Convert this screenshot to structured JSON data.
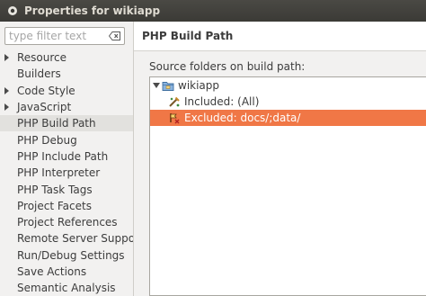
{
  "window": {
    "title": "Properties for wikiapp"
  },
  "sidebar": {
    "filter_placeholder": "type filter text",
    "items": [
      {
        "label": "Resource",
        "expandable": true
      },
      {
        "label": "Builders",
        "expandable": false
      },
      {
        "label": "Code Style",
        "expandable": true
      },
      {
        "label": "JavaScript",
        "expandable": true
      },
      {
        "label": "PHP Build Path",
        "expandable": false,
        "selected": true
      },
      {
        "label": "PHP Debug",
        "expandable": false
      },
      {
        "label": "PHP Include Path",
        "expandable": false
      },
      {
        "label": "PHP Interpreter",
        "expandable": false
      },
      {
        "label": "PHP Task Tags",
        "expandable": false
      },
      {
        "label": "Project Facets",
        "expandable": false
      },
      {
        "label": "Project References",
        "expandable": false
      },
      {
        "label": "Remote Server Suppor",
        "expandable": false
      },
      {
        "label": "Run/Debug Settings",
        "expandable": false
      },
      {
        "label": "Save Actions",
        "expandable": false
      },
      {
        "label": "Semantic Analysis",
        "expandable": false
      }
    ]
  },
  "content": {
    "header": "PHP Build Path",
    "section_label": "Source folders on build path:",
    "tree": {
      "root": {
        "label": "wikiapp",
        "icon": "package-folder-icon",
        "expanded": true
      },
      "children": [
        {
          "label": "Included: (All)",
          "icon": "included-filter-icon"
        },
        {
          "label": "Excluded: docs/;data/",
          "icon": "excluded-filter-icon",
          "selected": true
        }
      ]
    }
  },
  "colors": {
    "titlebar": "#3c3b37",
    "selection": "#f07746",
    "sidebar_selection": "#e2e1de",
    "background": "#f2f1f0"
  }
}
